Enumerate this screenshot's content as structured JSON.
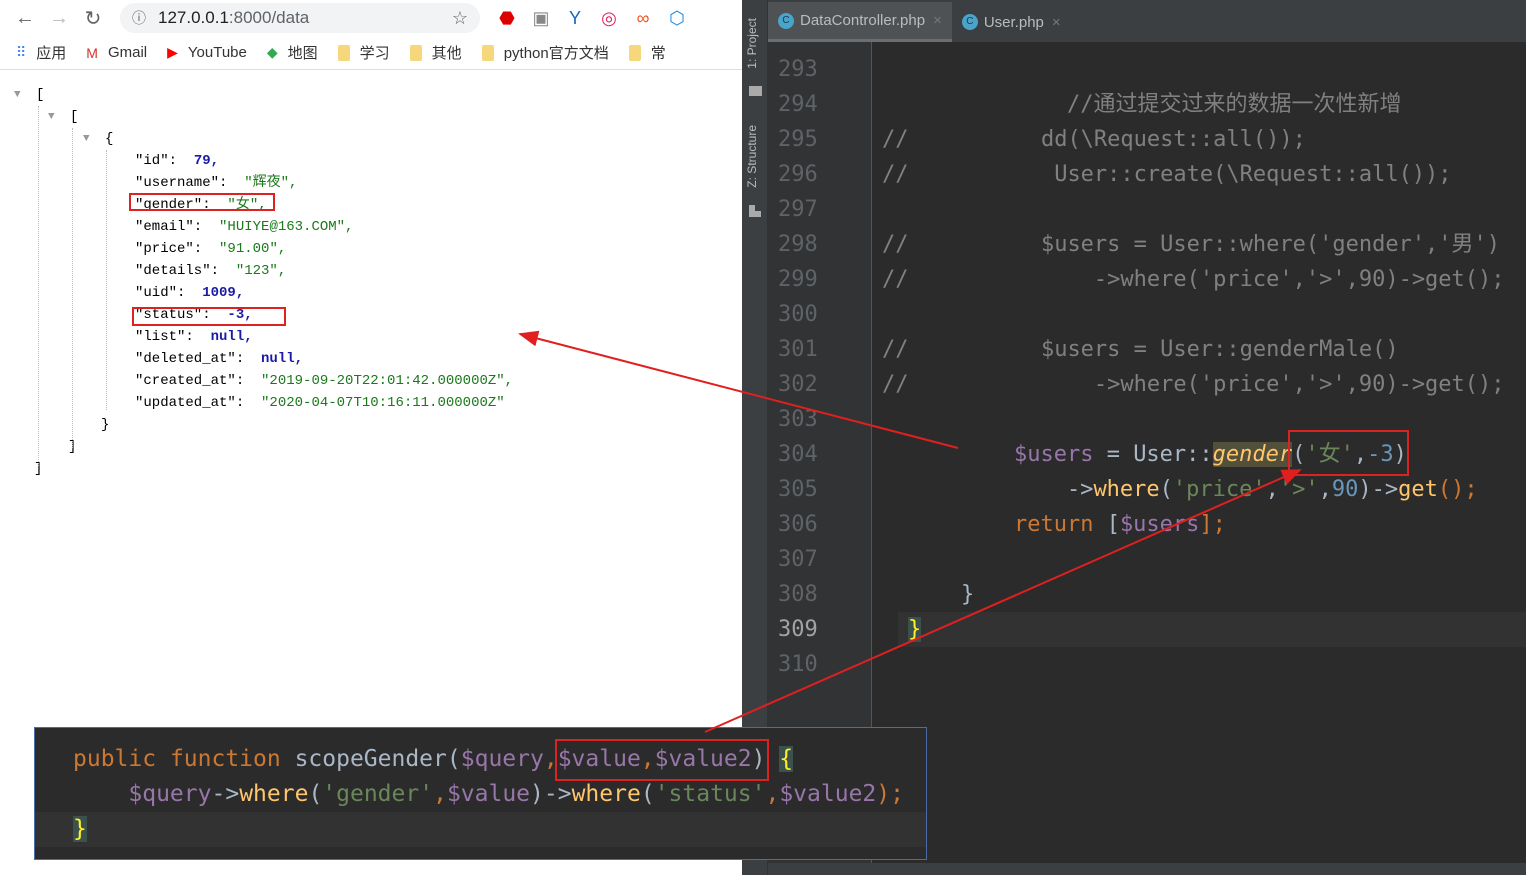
{
  "browser": {
    "url_host": "127.0.0.1",
    "url_rest": ":8000/data",
    "bookmarks": [
      {
        "label": "应用",
        "icon": "apps-grid-icon"
      },
      {
        "label": "Gmail",
        "icon": "gmail-icon"
      },
      {
        "label": "YouTube",
        "icon": "youtube-icon"
      },
      {
        "label": "地图",
        "icon": "maps-icon"
      },
      {
        "label": "学习",
        "icon": "folder-icon"
      },
      {
        "label": "其他",
        "icon": "folder-icon"
      },
      {
        "label": "python官方文档",
        "icon": "folder-icon"
      },
      {
        "label": "常",
        "icon": "folder-icon"
      }
    ]
  },
  "json": {
    "open_outer": "[",
    "open_inner": "[",
    "open_obj": "{",
    "close_obj": "}",
    "close_inner": "]",
    "close_outer": "]",
    "fields": [
      {
        "key": "\"id\": ",
        "value": "79,",
        "type": "num"
      },
      {
        "key": "\"username\": ",
        "value": "\"辉夜\",",
        "type": "str"
      },
      {
        "key": "\"gender\": ",
        "value": "\"女\",",
        "type": "str"
      },
      {
        "key": "\"email\": ",
        "value": "\"HUIYE@163.COM\",",
        "type": "str"
      },
      {
        "key": "\"price\": ",
        "value": "\"91.00\",",
        "type": "str"
      },
      {
        "key": "\"details\": ",
        "value": "\"123\",",
        "type": "str"
      },
      {
        "key": "\"uid\": ",
        "value": "1009,",
        "type": "num"
      },
      {
        "key": "\"status\": ",
        "value": "-3,",
        "type": "num"
      },
      {
        "key": "\"list\": ",
        "value": "null,",
        "type": "num"
      },
      {
        "key": "\"deleted_at\": ",
        "value": "null,",
        "type": "num"
      },
      {
        "key": "\"created_at\": ",
        "value": "\"2019-09-20T22:01:42.000000Z\",",
        "type": "str"
      },
      {
        "key": "\"updated_at\": ",
        "value": "\"2020-04-07T10:16:11.000000Z\"",
        "type": "str"
      }
    ]
  },
  "ide": {
    "side_tabs": [
      "1: Project",
      "Z: Structure"
    ],
    "tabs": [
      {
        "label": "DataController.php",
        "active": true
      },
      {
        "label": "User.php",
        "active": false
      }
    ],
    "lines": [
      {
        "n": "293",
        "tokens": []
      },
      {
        "n": "294",
        "tokens": [
          [
            "            ",
            ""
          ],
          [
            "//通过提交过来的数据一次性新增",
            "cm"
          ]
        ]
      },
      {
        "n": "295",
        "tokens": [
          [
            "//",
            "cm"
          ],
          [
            "          dd(\\Request::all());",
            "cm"
          ]
        ]
      },
      {
        "n": "296",
        "tokens": [
          [
            "//",
            "cm"
          ],
          [
            "           User::create(\\Request::all());",
            "cm"
          ]
        ]
      },
      {
        "n": "297",
        "tokens": []
      },
      {
        "n": "298",
        "tokens": [
          [
            "//",
            "cm"
          ],
          [
            "          $users = User::where('gender','男')",
            "cm"
          ]
        ]
      },
      {
        "n": "299",
        "tokens": [
          [
            "//",
            "cm"
          ],
          [
            "              ->where('price','>',90)->get();",
            "cm"
          ]
        ]
      },
      {
        "n": "300",
        "tokens": []
      },
      {
        "n": "301",
        "tokens": [
          [
            "//",
            "cm"
          ],
          [
            "          $users = User::genderMale()",
            "cm"
          ]
        ]
      },
      {
        "n": "302",
        "tokens": [
          [
            "//",
            "cm"
          ],
          [
            "              ->where('price','>',90)->get();",
            "cm"
          ]
        ]
      },
      {
        "n": "303",
        "tokens": []
      },
      {
        "n": "304",
        "tokens": [
          [
            "        ",
            ""
          ],
          [
            "$users",
            "var"
          ],
          [
            " = User::",
            ""
          ],
          [
            "gender",
            "hl"
          ],
          [
            "(",
            ""
          ],
          [
            "'女'",
            "str"
          ],
          [
            ",",
            ""
          ],
          [
            "-3",
            "num"
          ],
          [
            ")",
            ""
          ]
        ]
      },
      {
        "n": "305",
        "tokens": [
          [
            "            ->",
            ""
          ],
          [
            "where",
            "fn"
          ],
          [
            "(",
            ""
          ],
          [
            "'price'",
            "str"
          ],
          [
            ",",
            ""
          ],
          [
            "'>'",
            "str"
          ],
          [
            ",",
            ""
          ],
          [
            "90",
            "num"
          ],
          [
            ")->",
            ""
          ],
          [
            "get",
            "fn"
          ],
          [
            "();",
            "kw"
          ]
        ]
      },
      {
        "n": "306",
        "tokens": [
          [
            "        ",
            ""
          ],
          [
            "return ",
            "kw"
          ],
          [
            "[",
            ""
          ],
          [
            "$users",
            "var"
          ],
          [
            "];",
            "kw"
          ]
        ]
      },
      {
        "n": "307",
        "tokens": []
      },
      {
        "n": "308",
        "tokens": [
          [
            "    }",
            ""
          ]
        ]
      },
      {
        "n": "309",
        "tokens": [
          [
            "}",
            "br"
          ]
        ]
      },
      {
        "n": "310",
        "tokens": []
      }
    ],
    "current_line": "309"
  },
  "popup": {
    "lines": [
      [
        [
          "public ",
          "kw"
        ],
        [
          "function ",
          "kw"
        ],
        [
          "scopeGender",
          ""
        ],
        [
          "(",
          ""
        ],
        [
          "$query",
          "var"
        ],
        [
          ",",
          "kw"
        ],
        [
          "$value",
          "var"
        ],
        [
          ",",
          "kw"
        ],
        [
          "$value2",
          "var"
        ],
        [
          ") ",
          ""
        ],
        [
          "{",
          "br"
        ]
      ],
      [
        [
          "    ",
          ""
        ],
        [
          "$query",
          "var"
        ],
        [
          "->",
          ""
        ],
        [
          "where",
          "fn"
        ],
        [
          "(",
          ""
        ],
        [
          "'gender'",
          "str"
        ],
        [
          ",",
          "kw"
        ],
        [
          "$value",
          "var"
        ],
        [
          ")->",
          ""
        ],
        [
          "where",
          "fn"
        ],
        [
          "(",
          ""
        ],
        [
          "'status'",
          "str"
        ],
        [
          ",",
          "kw"
        ],
        [
          "$value2",
          "var"
        ],
        [
          ");",
          "kw"
        ]
      ],
      [
        [
          "}",
          "br"
        ]
      ]
    ]
  },
  "annotation_color": "#e02020"
}
